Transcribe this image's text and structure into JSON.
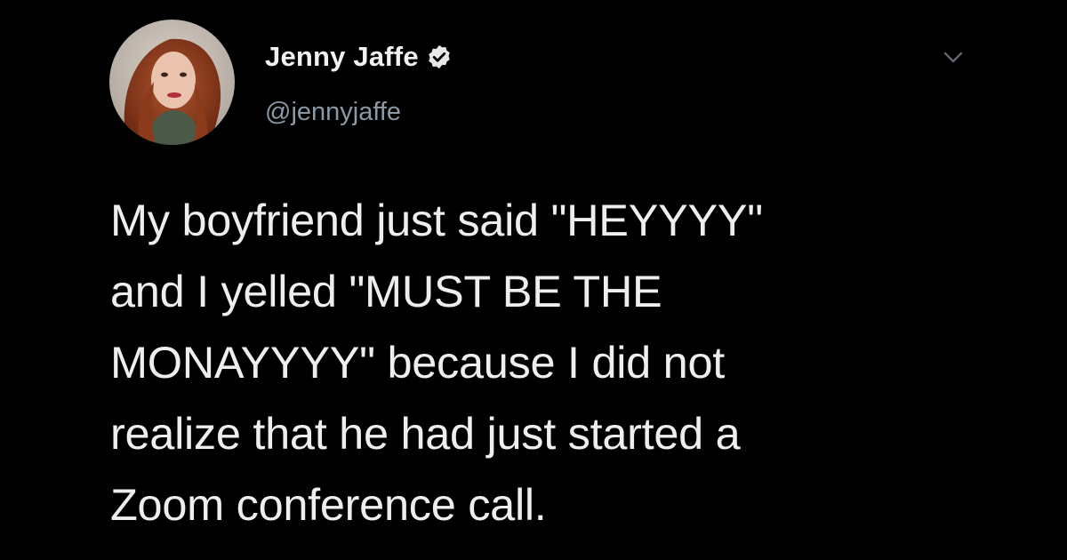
{
  "tweet": {
    "display_name": "Jenny Jaffe",
    "handle": "@jennyjaffe",
    "verified": true,
    "text": "My boyfriend just said \"HEYYYY\"\nand I yelled \"MUST BE THE\nMONAYYYY\" because I did not\nrealize that he had just started a\nZoom conference call.",
    "icons": {
      "verified": "verified-badge-icon",
      "menu": "chevron-down-icon",
      "avatar": "profile-photo"
    }
  },
  "colors": {
    "background": "#000000",
    "text": "#eeeeee",
    "handle": "#8b98a5",
    "chevron": "#5b6670"
  }
}
